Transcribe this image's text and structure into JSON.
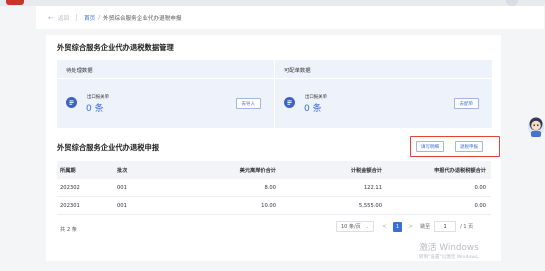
{
  "breadcrumb": {
    "back_label": "返回",
    "home": "首页",
    "separator": "/",
    "current": "外贸综合服务企业代办退税申报"
  },
  "data_section": {
    "title": "外贸综合服务企业代办退税数据管理",
    "pending": {
      "title": "待处理数据",
      "item_label": "出口报关单",
      "count": "0 条",
      "button": "去导入"
    },
    "assignable": {
      "title": "可配单数据",
      "item_label": "出口报关单",
      "count": "0 条",
      "button": "去配单"
    }
  },
  "declare_section": {
    "title": "外贸综合服务企业代办退税申报",
    "fill_button": "填写明细",
    "declare_button": "退税申报",
    "columns": [
      "所属期",
      "批次",
      "美元离岸价合计",
      "计税金额合计",
      "申报代办退税税额合计"
    ],
    "rows": [
      [
        "202302",
        "001",
        "8.00",
        "122.11",
        "0.00"
      ],
      [
        "202301",
        "001",
        "10.00",
        "5,555.00",
        "0.00"
      ]
    ]
  },
  "pagination": {
    "total": "共 2 条",
    "page_size": "10 条/页",
    "prev": "<",
    "current_page": "1",
    "next": ">",
    "jump_label": "跳至",
    "jump_value": "1",
    "page_count": "/ 1 页"
  },
  "watermark": {
    "line1": "激活 Windows",
    "line2": "转到\"设置\"以激活 Windows。"
  },
  "colors": {
    "accent": "#3a6ed8",
    "highlight_box": "#e0452e",
    "panel_bg": "#eef2fb"
  }
}
